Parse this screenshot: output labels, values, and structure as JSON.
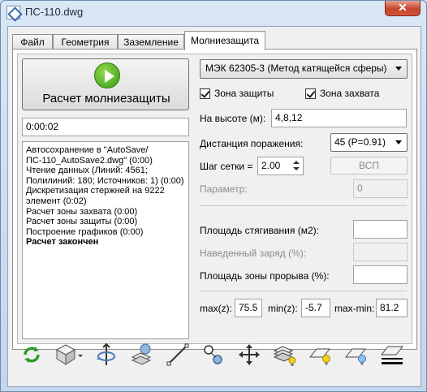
{
  "window": {
    "title": "ПС-110.dwg",
    "close_label": "✕"
  },
  "tabs": [
    {
      "label": "Файл"
    },
    {
      "label": "Геометрия"
    },
    {
      "label": "Заземление"
    },
    {
      "label": "Молниезащита"
    }
  ],
  "calc": {
    "button_label": "Расчет молниезащиты",
    "elapsed": "0:00:02"
  },
  "log": [
    {
      "text": "Автосохранение в \"AutoSave/ ПС-110_AutoSave2.dwg\" (0:00)",
      "bold": false
    },
    {
      "text": "Чтение данных (Линий: 4561;",
      "bold": false
    },
    {
      "text": "Полилиний: 180; Источников: 1) (0:00)",
      "bold": false
    },
    {
      "text": "Дискретизация стержней на 9222 элемент (0:02)",
      "bold": false
    },
    {
      "text": "Расчет зоны захвата (0:00)",
      "bold": false
    },
    {
      "text": "Расчет зоны защиты (0:00)",
      "bold": false
    },
    {
      "text": "Построение графиков (0:00)",
      "bold": false
    },
    {
      "text": "Расчет закончен",
      "bold": true
    }
  ],
  "settings": {
    "method": "МЭК 62305-3 (Метод катящейся сферы)",
    "zone_protection": {
      "label": "Зона защиты",
      "checked": true
    },
    "zone_capture": {
      "label": "Зона захвата",
      "checked": true
    },
    "height_label": "На высоте (м):",
    "height_value": "4,8,12",
    "distance_label": "Дистанция поражения:",
    "distance_value": "45 (P=0.91)",
    "grid_step_label": "Шаг сетки =",
    "grid_step_value": "2.00",
    "vsp_button": "ВСП",
    "param_label": "Параметр:",
    "param_value": "0",
    "area_label": "Площадь стягивания (м2):",
    "area_value": "",
    "charge_label": "Наведенный заряд (%):",
    "charge_value": "",
    "breakthrough_label": "Площадь зоны прорыва (%):",
    "breakthrough_value": "",
    "max_label": "max(z):",
    "max_value": "75.5",
    "min_label": "min(z):",
    "min_value": "-5.7",
    "maxmin_label": "max-min:",
    "maxmin_value": "81.2"
  },
  "toolbar": [
    {
      "icon": "refresh-icon"
    },
    {
      "icon": "view-cube-icon"
    },
    {
      "icon": "rotate-icon"
    },
    {
      "icon": "layers-icon"
    },
    {
      "icon": "line-icon"
    },
    {
      "icon": "points-icon"
    },
    {
      "icon": "move-arrows-icon"
    },
    {
      "icon": "layers-light-icon"
    },
    {
      "icon": "plane-light-icon"
    },
    {
      "icon": "plane-blue-light-icon"
    },
    {
      "icon": "plane-ground-icon"
    }
  ],
  "colors": {
    "accent_green": "#3c9a16",
    "title_bg": "#cfe0f1",
    "close_red": "#c7452d"
  }
}
